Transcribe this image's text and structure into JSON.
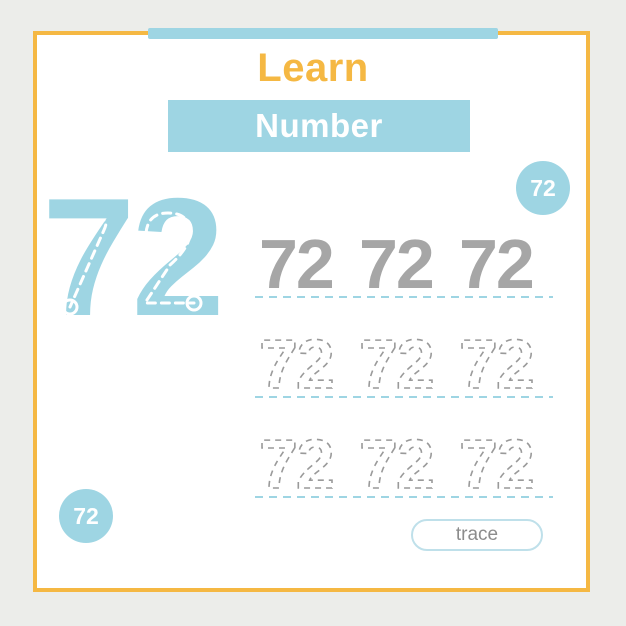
{
  "worksheet": {
    "title": "Learn",
    "subtitle": "Number",
    "number": "72",
    "trace_label": "trace",
    "badges": [
      {
        "name": "badge-top-right",
        "value": "72"
      },
      {
        "name": "badge-bottom-left",
        "value": "72"
      }
    ],
    "big_number": {
      "value": "72",
      "style": "dashed-guide-path"
    },
    "practice_rows": [
      {
        "style": "solid-gray",
        "items": [
          "72",
          "72",
          "72"
        ],
        "baseline": "blue-dashed"
      },
      {
        "style": "dashed-outline",
        "items": [
          "72",
          "72",
          "72"
        ],
        "baseline": "blue-dashed"
      },
      {
        "style": "dashed-outline",
        "items": [
          "72",
          "72",
          "72"
        ],
        "baseline": "blue-dashed"
      }
    ],
    "colors": {
      "frame": "#f5b843",
      "accent_blue": "#9ed5e3",
      "title": "#f5b843",
      "gray_number": "#a6a6a6",
      "outline_number": "#9a9a9a",
      "baseline": "#9ed5e3",
      "background": "#ecedea",
      "paper": "#ffffff",
      "trace_text": "#8c8c8c",
      "trace_border": "#bfe0ea"
    }
  }
}
